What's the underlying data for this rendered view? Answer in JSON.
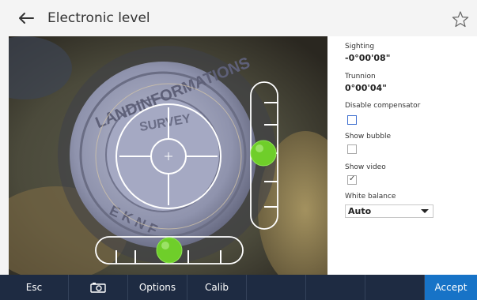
{
  "header": {
    "title": "Electronic level",
    "back_icon": "arrow-left-icon",
    "favorite_icon": "star-outline-icon"
  },
  "level": {
    "sighting_label": "Sighting",
    "sighting_value": "-0°00'08\"",
    "trunnion_label": "Trunnion",
    "trunnion_value": "0°00'04\"",
    "disable_compensator_label": "Disable compensator",
    "disable_compensator_checked": false,
    "show_bubble_label": "Show bubble",
    "show_bubble_checked": false,
    "show_video_label": "Show video",
    "show_video_checked": true,
    "white_balance_label": "White balance",
    "white_balance_value": "Auto"
  },
  "viewport": {
    "marker_text_top": "LANDINFORMATIONS",
    "marker_text_inner": "SURVEY",
    "marker_text_bottom": "E K N F"
  },
  "toolbar": {
    "esc": "Esc",
    "camera_icon": "camera-icon",
    "options": "Options",
    "calib": "Calib",
    "accept": "Accept"
  },
  "colors": {
    "bottombar": "#1e2b42",
    "accept": "#1773c7",
    "bubble": "#6fce2a"
  }
}
